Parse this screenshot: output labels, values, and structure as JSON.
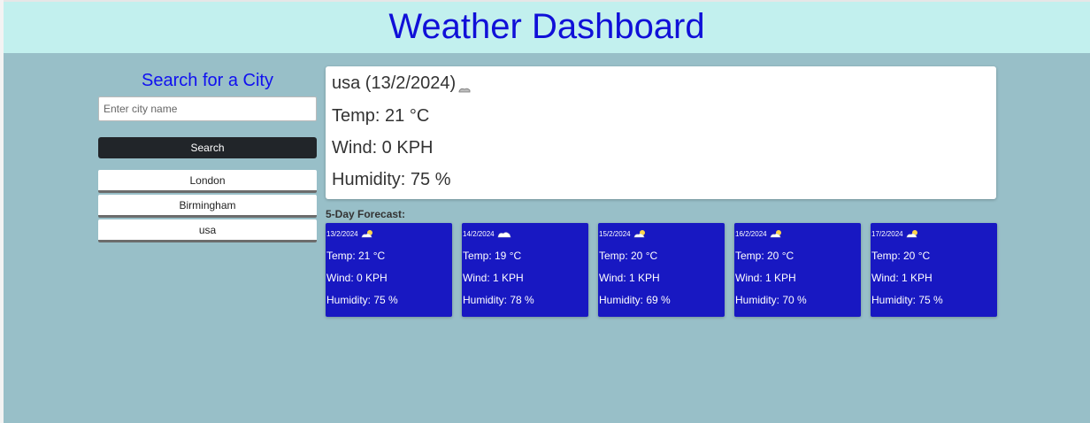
{
  "header": {
    "title": "Weather Dashboard"
  },
  "search": {
    "title": "Search for a City",
    "placeholder": "Enter city name",
    "button_label": "Search",
    "history": [
      "London",
      "Birmingham",
      "usa"
    ]
  },
  "current": {
    "city_date": "usa (13/2/2024)",
    "icon": "cloud-icon",
    "temp": "Temp: 21 °C",
    "wind": "Wind: 0 KPH",
    "humidity": "Humidity: 75 %"
  },
  "forecast": {
    "title": "5-Day Forecast:",
    "days": [
      {
        "date": "13/2/2024",
        "icon": "sun-cloud-icon",
        "temp": "Temp: 21 °C",
        "wind": "Wind: 0 KPH",
        "humidity": "Humidity: 75 %"
      },
      {
        "date": "14/2/2024",
        "icon": "cloud-icon",
        "temp": "Temp: 19 °C",
        "wind": "Wind: 1 KPH",
        "humidity": "Humidity: 78 %"
      },
      {
        "date": "15/2/2024",
        "icon": "sun-cloud-icon",
        "temp": "Temp: 20 °C",
        "wind": "Wind: 1 KPH",
        "humidity": "Humidity: 69 %"
      },
      {
        "date": "16/2/2024",
        "icon": "sun-cloud-icon",
        "temp": "Temp: 20 °C",
        "wind": "Wind: 1 KPH",
        "humidity": "Humidity: 70 %"
      },
      {
        "date": "17/2/2024",
        "icon": "sun-cloud-icon",
        "temp": "Temp: 20 °C",
        "wind": "Wind: 1 KPH",
        "humidity": "Humidity: 75 %"
      }
    ]
  },
  "colors": {
    "header_bg": "#c2f0ee",
    "page_bg": "#98bfc8",
    "title_text": "#1010d8",
    "card_bg": "#1818c2",
    "button_bg": "#212529"
  }
}
